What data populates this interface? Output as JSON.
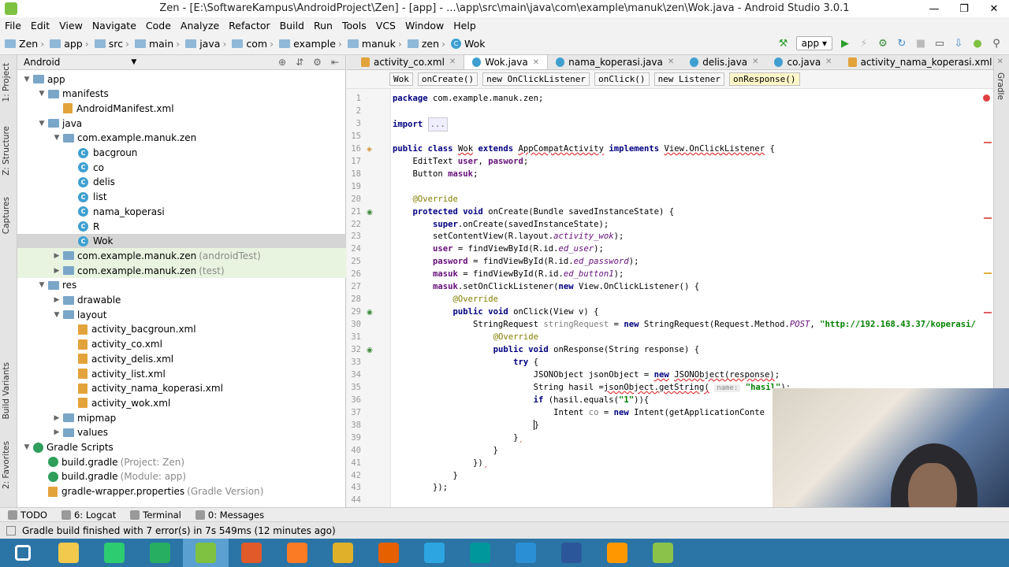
{
  "window": {
    "title": "Zen - [E:\\SoftwareKampus\\AndroidProject\\Zen] - [app] - ...\\app\\src\\main\\java\\com\\example\\manuk\\zen\\Wok.java - Android Studio 3.0.1",
    "minimize": "—",
    "maximize": "❐",
    "close": "✕"
  },
  "menu": [
    "File",
    "Edit",
    "View",
    "Navigate",
    "Code",
    "Analyze",
    "Refactor",
    "Build",
    "Run",
    "Tools",
    "VCS",
    "Window",
    "Help"
  ],
  "nav_breadcrumb": [
    "Zen",
    "app",
    "src",
    "main",
    "java",
    "com",
    "example",
    "manuk",
    "zen",
    "Wok"
  ],
  "run_config": "app",
  "left_tool_tabs": [
    "1: Project",
    "Z: Structure",
    "Captures",
    "Build Variants",
    "2: Favorites"
  ],
  "right_tool_tabs": [
    "Gradle"
  ],
  "project_panel": {
    "view_mode": "Android",
    "tree": [
      {
        "label": "app",
        "suffix": "",
        "indent": 0,
        "icon": "folder",
        "expanded": true
      },
      {
        "label": "manifests",
        "suffix": "",
        "indent": 1,
        "icon": "folder",
        "expanded": true
      },
      {
        "label": "AndroidManifest.xml",
        "suffix": "",
        "indent": 2,
        "icon": "xml",
        "expanded": null
      },
      {
        "label": "java",
        "suffix": "",
        "indent": 1,
        "icon": "folder",
        "expanded": true
      },
      {
        "label": "com.example.manuk.zen",
        "suffix": "",
        "indent": 2,
        "icon": "folder",
        "expanded": true
      },
      {
        "label": "bacgroun",
        "suffix": "",
        "indent": 3,
        "icon": "class",
        "expanded": null
      },
      {
        "label": "co",
        "suffix": "",
        "indent": 3,
        "icon": "class",
        "expanded": null
      },
      {
        "label": "delis",
        "suffix": "",
        "indent": 3,
        "icon": "class",
        "expanded": null
      },
      {
        "label": "list",
        "suffix": "",
        "indent": 3,
        "icon": "class",
        "expanded": null
      },
      {
        "label": "nama_koperasi",
        "suffix": "",
        "indent": 3,
        "icon": "class",
        "expanded": null
      },
      {
        "label": "R",
        "suffix": "",
        "indent": 3,
        "icon": "class",
        "expanded": null
      },
      {
        "label": "Wok",
        "suffix": "",
        "indent": 3,
        "icon": "class",
        "expanded": null,
        "selected": true
      },
      {
        "label": "com.example.manuk.zen",
        "suffix": "(androidTest)",
        "indent": 2,
        "icon": "folder",
        "expanded": false,
        "test": true
      },
      {
        "label": "com.example.manuk.zen",
        "suffix": "(test)",
        "indent": 2,
        "icon": "folder",
        "expanded": false,
        "test": true
      },
      {
        "label": "res",
        "suffix": "",
        "indent": 1,
        "icon": "folder",
        "expanded": true
      },
      {
        "label": "drawable",
        "suffix": "",
        "indent": 2,
        "icon": "folder",
        "expanded": false
      },
      {
        "label": "layout",
        "suffix": "",
        "indent": 2,
        "icon": "folder",
        "expanded": true
      },
      {
        "label": "activity_bacgroun.xml",
        "suffix": "",
        "indent": 3,
        "icon": "xml",
        "expanded": null
      },
      {
        "label": "activity_co.xml",
        "suffix": "",
        "indent": 3,
        "icon": "xml",
        "expanded": null
      },
      {
        "label": "activity_delis.xml",
        "suffix": "",
        "indent": 3,
        "icon": "xml",
        "expanded": null
      },
      {
        "label": "activity_list.xml",
        "suffix": "",
        "indent": 3,
        "icon": "xml",
        "expanded": null
      },
      {
        "label": "activity_nama_koperasi.xml",
        "suffix": "",
        "indent": 3,
        "icon": "xml",
        "expanded": null
      },
      {
        "label": "activity_wok.xml",
        "suffix": "",
        "indent": 3,
        "icon": "xml",
        "expanded": null
      },
      {
        "label": "mipmap",
        "suffix": "",
        "indent": 2,
        "icon": "folder",
        "expanded": false
      },
      {
        "label": "values",
        "suffix": "",
        "indent": 2,
        "icon": "folder",
        "expanded": false
      },
      {
        "label": "Gradle Scripts",
        "suffix": "",
        "indent": 0,
        "icon": "gradle",
        "expanded": true
      },
      {
        "label": "build.gradle",
        "suffix": "(Project: Zen)",
        "indent": 1,
        "icon": "gradle",
        "expanded": null
      },
      {
        "label": "build.gradle",
        "suffix": "(Module: app)",
        "indent": 1,
        "icon": "gradle",
        "expanded": null
      },
      {
        "label": "gradle-wrapper.properties",
        "suffix": "(Gradle Version)",
        "indent": 1,
        "icon": "xml",
        "expanded": null
      }
    ]
  },
  "editor_tabs": [
    {
      "label": "activity_co.xml",
      "kind": "xml",
      "active": false
    },
    {
      "label": "Wok.java",
      "kind": "class",
      "active": true
    },
    {
      "label": "nama_koperasi.java",
      "kind": "class",
      "active": false
    },
    {
      "label": "delis.java",
      "kind": "class",
      "active": false
    },
    {
      "label": "co.java",
      "kind": "class",
      "active": false
    },
    {
      "label": "activity_nama_koperasi.xml",
      "kind": "xml",
      "active": false
    }
  ],
  "code_breadcrumbs": [
    "Wok",
    "onCreate()",
    "new OnClickListener",
    "onClick()",
    "new Listener",
    "onResponse()"
  ],
  "code_lines": [
    {
      "n": "1",
      "html": "<span class='kw'>package</span> com.example.manuk.zen;"
    },
    {
      "n": "2",
      "html": ""
    },
    {
      "n": "3",
      "html": "<span class='kw'>import</span> <span class='fold'>...</span>"
    },
    {
      "n": "15",
      "html": ""
    },
    {
      "n": "16",
      "html": "<span class='kw'>public class</span> <span class='ul'>Wok</span> <span class='kw'>extends</span> <span class='ul'>AppCompatActivity</span> <span class='kw'>implements</span> <span class='ul'>View.OnClickListener</span> {"
    },
    {
      "n": "17",
      "html": "    EditText <span class='fl'>user</span>, <span class='fl'>pasword</span>;"
    },
    {
      "n": "18",
      "html": "    Button <span class='fl'>masuk</span>;"
    },
    {
      "n": "19",
      "html": ""
    },
    {
      "n": "20",
      "html": "    <span class='an'>@Override</span>"
    },
    {
      "n": "21",
      "html": "    <span class='kw'>protected void</span> onCreate(Bundle savedInstanceState) {"
    },
    {
      "n": "22",
      "html": "        <span class='kw'>super</span>.onCreate(savedInstanceState);"
    },
    {
      "n": "23",
      "html": "        setContentView(R.layout.<span class='fc'>activity_wok</span>);"
    },
    {
      "n": "24",
      "html": "        <span class='fl'>user</span> = findViewById(R.id.<span class='fc'>ed_user</span>);"
    },
    {
      "n": "25",
      "html": "        <span class='fl'>pasword</span> = findViewById(R.id.<span class='fc'>ed_password</span>);"
    },
    {
      "n": "26",
      "html": "        <span class='fl'>masuk</span> = findViewById(R.id.<span class='fc'>ed_button1</span>);"
    },
    {
      "n": "27",
      "html": "        <span class='fl'>masuk</span>.setOnClickListener(<span class='kw'>new</span> View.OnClickListener() {"
    },
    {
      "n": "28",
      "html": "            <span class='an'>@Override</span>"
    },
    {
      "n": "29",
      "html": "            <span class='kw'>public void</span> onClick(View v) {"
    },
    {
      "n": "30",
      "html": "                StringRequest <span style='color:#808080'>stringRequest</span> = <span class='kw'>new</span> StringRequest(Request.Method.<span class='fc'>POST</span>, <span class='st'>\"http://192.168.43.37/koperasi/</span>"
    },
    {
      "n": "31",
      "html": "                    <span class='an'>@Override</span>"
    },
    {
      "n": "32",
      "html": "                    <span class='kw'>public void</span> onResponse(String response) {"
    },
    {
      "n": "33",
      "html": "                        <span class='kw'>try</span> {"
    },
    {
      "n": "34",
      "html": "                            JSONObject jsonObject = <span class='kw ul'>new</span> <span class='ul'>JSONObject(response)</span>;"
    },
    {
      "n": "35",
      "html": "                            String hasil =<span class='ul'>jsonObject.getString(</span> <span class='hint'>name:</span> <span class='st'>\"hasil\"</span>);"
    },
    {
      "n": "36",
      "html": "                            <span class='kw'>if</span> (hasil.equals(<span class='st'>\"1\"</span>)){"
    },
    {
      "n": "37",
      "html": "                                Intent <span style='color:#808080'>co</span> = <span class='kw'>new</span> Intent(getApplicationConte"
    },
    {
      "n": "38",
      "html": "                            <span class='caret'></span>}"
    },
    {
      "n": "39",
      "html": "                        }<span style='color:#e03030'>ˏ</span>"
    },
    {
      "n": "40",
      "html": "                    }"
    },
    {
      "n": "41",
      "html": "                })<span style='color:#e03030'>ˏ</span>"
    },
    {
      "n": "42",
      "html": "            }"
    },
    {
      "n": "43",
      "html": "        });"
    },
    {
      "n": "44",
      "html": ""
    }
  ],
  "bottom_tools": [
    {
      "label": "TODO"
    },
    {
      "label": "6: Logcat"
    },
    {
      "label": "Terminal"
    },
    {
      "label": "0: Messages"
    }
  ],
  "status": "Gradle build finished with 7 error(s) in 7s 549ms (12 minutes ago)",
  "taskbar": [
    {
      "name": "windows-start",
      "color": "#ffffff"
    },
    {
      "name": "file-explorer",
      "color": "#f2c94c"
    },
    {
      "name": "store",
      "color": "#2ecc71"
    },
    {
      "name": "wifi-hotspot",
      "color": "#27ae60"
    },
    {
      "name": "android-studio",
      "color": "#7fc241"
    },
    {
      "name": "matlab",
      "color": "#e05a2a"
    },
    {
      "name": "xampp",
      "color": "#fb7a24"
    },
    {
      "name": "chrome",
      "color": "#e0b02a"
    },
    {
      "name": "firefox",
      "color": "#e66000"
    },
    {
      "name": "telegram",
      "color": "#2ca5e0"
    },
    {
      "name": "arduino",
      "color": "#00979c"
    },
    {
      "name": "vscode",
      "color": "#2b8fd6"
    },
    {
      "name": "word",
      "color": "#2b579a"
    },
    {
      "name": "sublime",
      "color": "#ff9800"
    },
    {
      "name": "notepad",
      "color": "#8bc34a"
    }
  ]
}
